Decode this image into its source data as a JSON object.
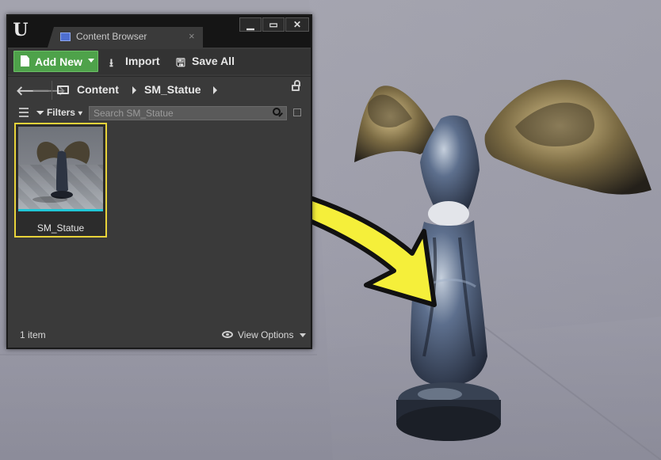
{
  "window": {
    "tab_label": "Content Browser",
    "tab_close": "×",
    "minimize": "▁",
    "maximize": "▭",
    "close": "✕"
  },
  "toolbar": {
    "add_new_label": "Add New",
    "import_label": "Import",
    "save_all_label": "Save All"
  },
  "breadcrumb": {
    "back": "🡐",
    "forward": "🡒",
    "items": [
      "Content",
      "SM_Statue"
    ]
  },
  "filters": {
    "label": "Filters",
    "search_placeholder": "Search SM_Statue"
  },
  "assets": [
    {
      "name": "SM_Statue",
      "selected": true
    }
  ],
  "status": {
    "item_count": "1 item",
    "view_options_label": "View Options"
  },
  "colors": {
    "add_new_bg": "#4ea24a",
    "selection_border": "#e8d33a",
    "asset_type_bar": "#21c6d6",
    "arrow_fill": "#f5ef3a"
  }
}
